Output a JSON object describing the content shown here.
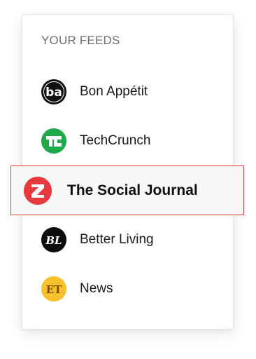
{
  "panel": {
    "header": "YOUR FEEDS"
  },
  "feeds": [
    {
      "label": "Bon Appétit",
      "icon": "bon-appetit-logo-icon",
      "icon_text": "ba",
      "color": "#111111"
    },
    {
      "label": "TechCrunch",
      "icon": "techcrunch-logo-icon",
      "icon_text": "TC",
      "color": "#1ea94a"
    },
    {
      "label": "The Social Journal",
      "icon": "social-journal-logo-icon",
      "icon_text": "Z",
      "color": "#e63a3f",
      "selected": true
    },
    {
      "label": "Better Living",
      "icon": "better-living-logo-icon",
      "icon_text": "BL",
      "color": "#0d0d0d"
    },
    {
      "label": "News",
      "icon": "entertainment-tonight-logo-icon",
      "icon_text": "ET",
      "color": "#f6c12c"
    }
  ],
  "colors": {
    "selected_border": "#e0393e",
    "selected_background": "#f7f7f7",
    "header_text": "#6e6e6e"
  }
}
